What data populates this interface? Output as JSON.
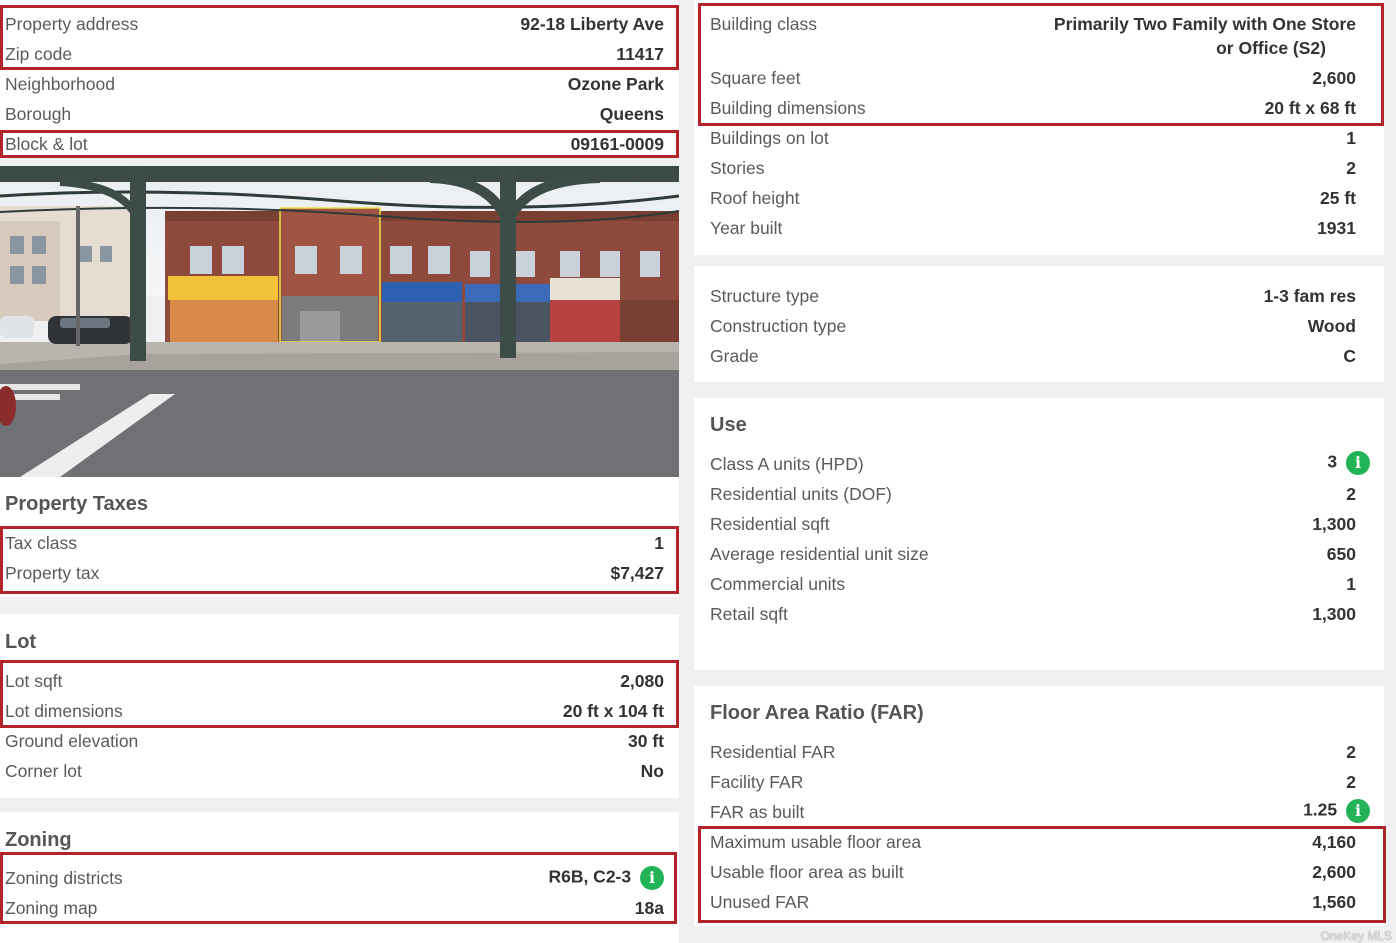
{
  "address": [
    {
      "label": "Property address",
      "value": "92-18 Liberty Ave"
    },
    {
      "label": "Zip code",
      "value": "11417"
    },
    {
      "label": "Neighborhood",
      "value": "Ozone Park"
    },
    {
      "label": "Borough",
      "value": "Queens"
    },
    {
      "label": "Block & lot",
      "value": "09161-0009"
    }
  ],
  "taxes": {
    "title": "Property Taxes",
    "rows": [
      {
        "label": "Tax class",
        "value": "1"
      },
      {
        "label": "Property tax",
        "value": "$7,427"
      }
    ]
  },
  "lot": {
    "title": "Lot",
    "rows": [
      {
        "label": "Lot sqft",
        "value": "2,080"
      },
      {
        "label": "Lot dimensions",
        "value": "20 ft x 104 ft"
      },
      {
        "label": "Ground elevation",
        "value": "30 ft"
      },
      {
        "label": "Corner lot",
        "value": "No"
      }
    ]
  },
  "zoning": {
    "title": "Zoning",
    "rows": [
      {
        "label": "Zoning districts",
        "value": "R6B, C2-3"
      },
      {
        "label": "Zoning map",
        "value": "18a"
      }
    ]
  },
  "building": {
    "class_label": "Building class",
    "class_value_line1": "Primarily Two Family with One Store",
    "class_value_line2": "or Office (S2)",
    "rows": [
      {
        "label": "Square feet",
        "value": "2,600"
      },
      {
        "label": "Building dimensions",
        "value": "20 ft x 68 ft"
      },
      {
        "label": "Buildings on lot",
        "value": "1"
      },
      {
        "label": "Stories",
        "value": "2"
      },
      {
        "label": "Roof height",
        "value": "25 ft"
      },
      {
        "label": "Year built",
        "value": "1931"
      }
    ]
  },
  "structure": [
    {
      "label": "Structure type",
      "value": "1-3 fam res"
    },
    {
      "label": "Construction type",
      "value": "Wood"
    },
    {
      "label": "Grade",
      "value": "C"
    }
  ],
  "use": {
    "title": "Use",
    "rows": [
      {
        "label": "Class A units (HPD)",
        "value": "3"
      },
      {
        "label": "Residential units (DOF)",
        "value": "2"
      },
      {
        "label": "Residential sqft",
        "value": "1,300"
      },
      {
        "label": "Average residential unit size",
        "value": "650"
      },
      {
        "label": "Commercial units",
        "value": "1"
      },
      {
        "label": "Retail sqft",
        "value": "1,300"
      }
    ]
  },
  "far": {
    "title": "Floor Area Ratio (FAR)",
    "rows": [
      {
        "label": "Residential FAR",
        "value": "2"
      },
      {
        "label": "Facility FAR",
        "value": "2"
      },
      {
        "label": "FAR as built",
        "value": "1.25"
      },
      {
        "label": "Maximum usable floor area",
        "value": "4,160"
      },
      {
        "label": "Usable floor area as built",
        "value": "2,600"
      },
      {
        "label": "Unused FAR",
        "value": "1,560"
      }
    ]
  },
  "info_icon_glyph": "i",
  "watermark": "OneKey MLS",
  "colors": {
    "highlight": "#b3232a",
    "info": "#22b357",
    "link": "#1f7fb0"
  }
}
